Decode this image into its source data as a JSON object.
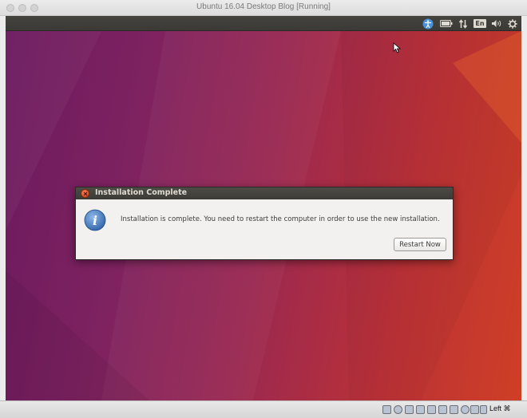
{
  "window": {
    "title": "Ubuntu 16.04 Desktop Blog [Running]"
  },
  "topbar": {
    "icons": [
      "accessibility-icon",
      "battery-icon",
      "network-icon",
      "keyboard-language-icon",
      "sound-icon",
      "gear-icon"
    ],
    "language": "En"
  },
  "dialog": {
    "title": "Installation Complete",
    "message": "Installation is complete. You need to restart the computer in order to use the new installation.",
    "button_label": "Restart Now",
    "icon": "info-icon"
  },
  "statusbar": {
    "icons": [
      "hard-disk-icon",
      "optical-drive-icon",
      "audio-icon",
      "network-adapter-icon",
      "usb-icon",
      "shared-folder-icon",
      "display-icon",
      "recording-icon",
      "cpu-icon",
      "mouse-integration-icon"
    ],
    "host_key": "Left ⌘"
  },
  "colors": {
    "accent_orange": "#dd4814",
    "panel_dark": "#3c3b37",
    "dialog_bg": "#f2f1f0"
  }
}
